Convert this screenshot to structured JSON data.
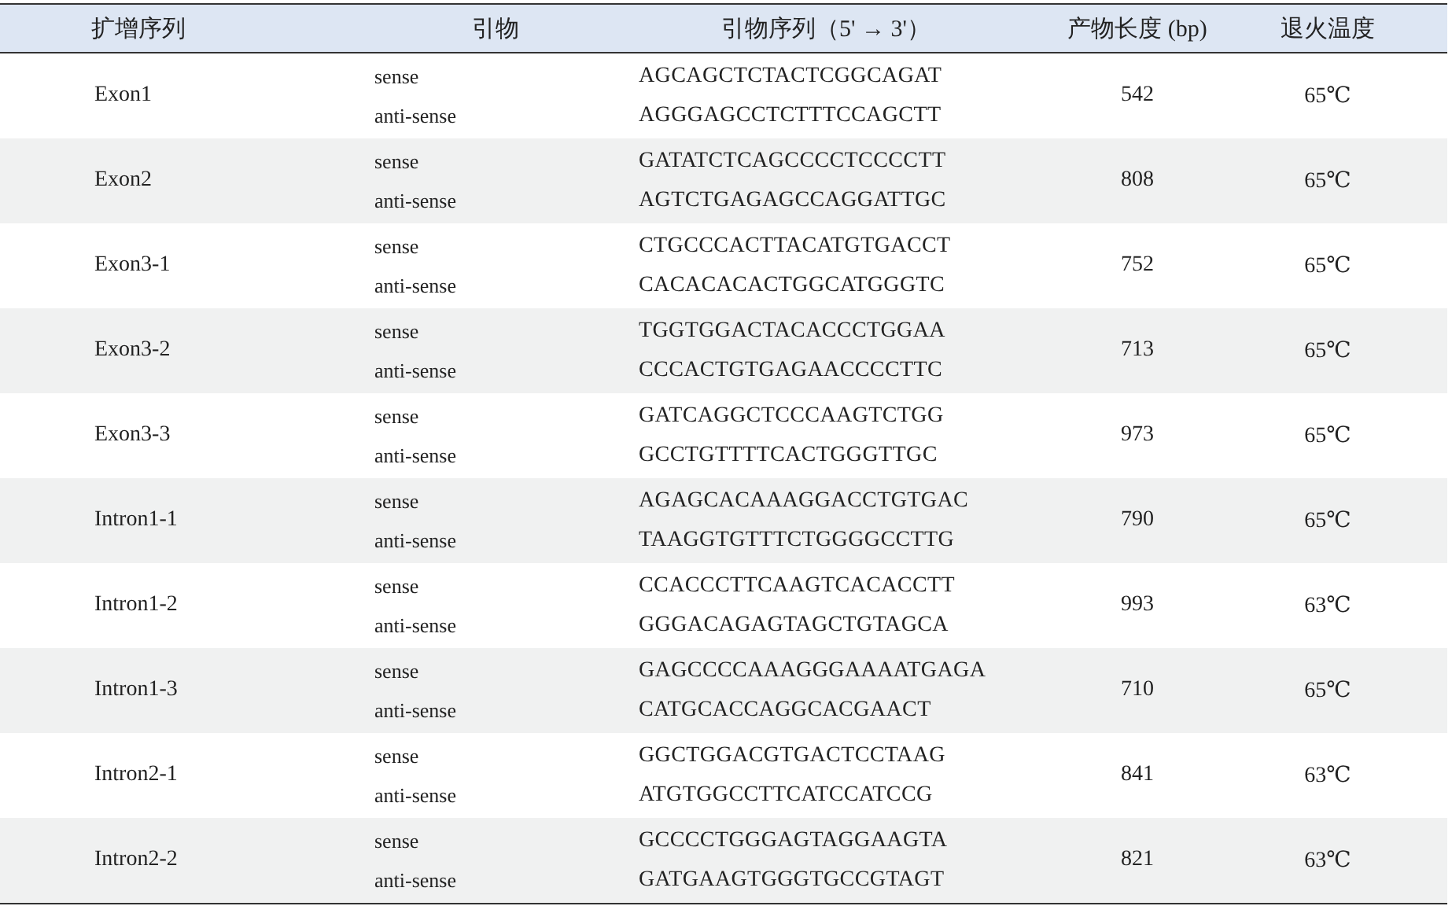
{
  "table": {
    "columns": [
      "扩增序列",
      "引物",
      "引物序列（5' → 3'）",
      "产物长度 (bp)",
      "退火温度"
    ],
    "rows": [
      {
        "target": "Exon1",
        "primers": [
          {
            "type": "sense",
            "sequence": "AGCAGCTCTACTCGGCAGAT"
          },
          {
            "type": "anti-sense",
            "sequence": "AGGGAGCCTCTTTCCAGCTT"
          }
        ],
        "length": "542",
        "temperature": "65℃"
      },
      {
        "target": "Exon2",
        "primers": [
          {
            "type": "sense",
            "sequence": "GATATCTCAGCCCCTCCCCTT"
          },
          {
            "type": "anti-sense",
            "sequence": "AGTCTGAGAGCCAGGATTGC"
          }
        ],
        "length": "808",
        "temperature": "65℃"
      },
      {
        "target": "Exon3-1",
        "primers": [
          {
            "type": "sense",
            "sequence": "CTGCCCACTTACATGTGACCT"
          },
          {
            "type": "anti-sense",
            "sequence": "CACACACACTGGCATGGGTC"
          }
        ],
        "length": "752",
        "temperature": "65℃"
      },
      {
        "target": "Exon3-2",
        "primers": [
          {
            "type": "sense",
            "sequence": "TGGTGGACTACACCCTGGAA"
          },
          {
            "type": "anti-sense",
            "sequence": "CCCACTGTGAGAACCCCTTC"
          }
        ],
        "length": "713",
        "temperature": "65℃"
      },
      {
        "target": "Exon3-3",
        "primers": [
          {
            "type": "sense",
            "sequence": "GATCAGGCTCCCAAGTCTGG"
          },
          {
            "type": "anti-sense",
            "sequence": "GCCTGTTTTCACTGGGTTGC"
          }
        ],
        "length": "973",
        "temperature": "65℃"
      },
      {
        "target": "Intron1-1",
        "primers": [
          {
            "type": "sense",
            "sequence": "AGAGCACAAAGGACCTGTGAC"
          },
          {
            "type": "anti-sense",
            "sequence": "TAAGGTGTTTCTGGGGCCTTG"
          }
        ],
        "length": "790",
        "temperature": "65℃"
      },
      {
        "target": "Intron1-2",
        "primers": [
          {
            "type": "sense",
            "sequence": "CCACCCTTCAAGTCACACCTT"
          },
          {
            "type": "anti-sense",
            "sequence": "GGGACAGAGTAGCTGTAGCA"
          }
        ],
        "length": "993",
        "temperature": "63℃"
      },
      {
        "target": "Intron1-3",
        "primers": [
          {
            "type": "sense",
            "sequence": "GAGCCCCAAAGGGAAAATGAGA"
          },
          {
            "type": "anti-sense",
            "sequence": "CATGCACCAGGCACGAACT"
          }
        ],
        "length": "710",
        "temperature": "65℃"
      },
      {
        "target": "Intron2-1",
        "primers": [
          {
            "type": "sense",
            "sequence": "GGCTGGACGTGACTCCTAAG"
          },
          {
            "type": "anti-sense",
            "sequence": "ATGTGGCCTTCATCCATCCG"
          }
        ],
        "length": "841",
        "temperature": "63℃"
      },
      {
        "target": "Intron2-2",
        "primers": [
          {
            "type": "sense",
            "sequence": "GCCCCTGGGAGTAGGAAGTA"
          },
          {
            "type": "anti-sense",
            "sequence": "GATGAAGTGGGTGCCGTAGT"
          }
        ],
        "length": "821",
        "temperature": "63℃"
      }
    ]
  }
}
